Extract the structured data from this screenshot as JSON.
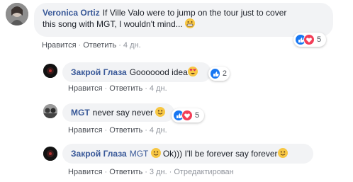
{
  "comments": [
    {
      "author": "Veronica Ortiz",
      "text_line1": "If Ville Valo were to jump on the tour just to cover",
      "text_line2": "this song with MGT, I wouldn't mind...",
      "actions": {
        "like": "Нравится",
        "reply": "Ответить",
        "time": "4 дн."
      },
      "reactions": {
        "count": "5",
        "types": [
          "like-icon",
          "love-icon"
        ]
      },
      "colors": {
        "like": "#1877f2",
        "love": "#f33e58"
      }
    },
    {
      "author": "Закрой Глаза",
      "text": "Gooooood idea",
      "actions": {
        "like": "Нравится",
        "reply": "Ответить",
        "time": "4 дн."
      },
      "reactions": {
        "count": "2",
        "types": [
          "like-icon"
        ]
      }
    },
    {
      "author": "MGT",
      "text": "never say never",
      "actions": {
        "like": "Нравится",
        "reply": "Ответить",
        "time": "4 дн."
      },
      "reactions": {
        "count": "5",
        "types": [
          "like-icon",
          "love-icon"
        ]
      }
    },
    {
      "author": "Закрой Глаза",
      "mention": "MGT",
      "text": "Ok))) I'll be forever say forever",
      "actions": {
        "like": "Нравится",
        "reply": "Ответить",
        "time": "3 дн.",
        "edited": "Отредактирован"
      }
    }
  ]
}
